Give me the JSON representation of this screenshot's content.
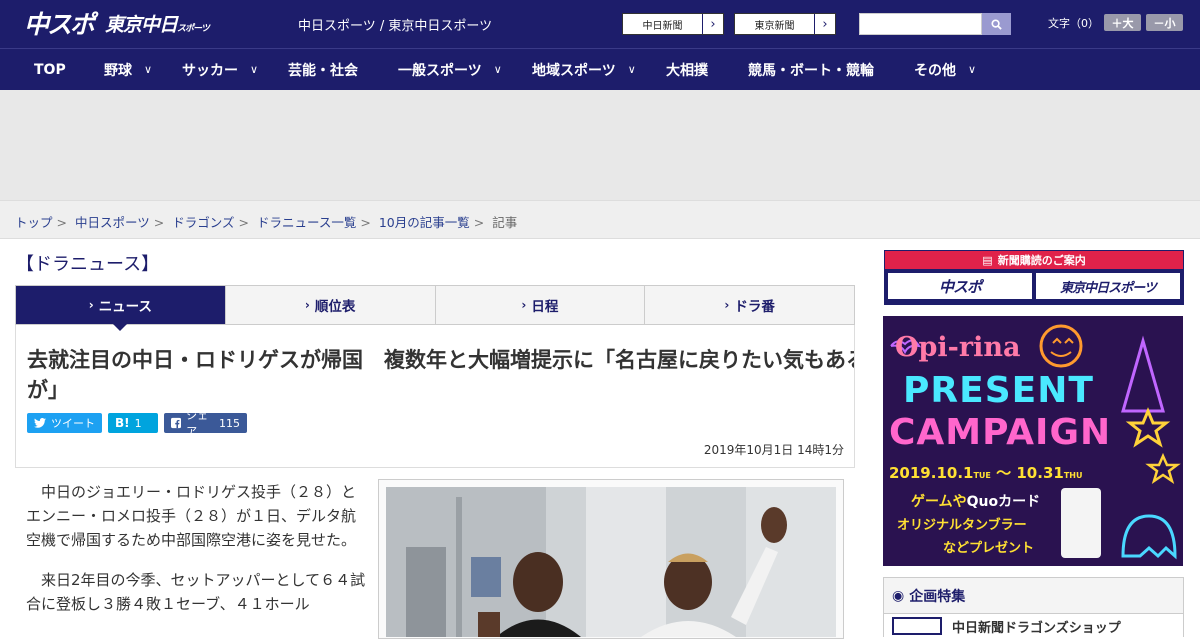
{
  "header": {
    "logo_main": "中スポ",
    "logo_sub": "東京中日",
    "logo_sub_small": "スポーツ",
    "site_links": "中日スポーツ / 東京中日スポーツ",
    "paper_buttons": [
      "中日新聞",
      "東京新聞"
    ],
    "search_placeholder": "",
    "font_label": "文字（0）",
    "font_up": "＋大",
    "font_down": "－小"
  },
  "nav": {
    "items": [
      {
        "label": "TOP",
        "dropdown": false
      },
      {
        "label": "野球",
        "dropdown": true
      },
      {
        "label": "サッカー",
        "dropdown": true
      },
      {
        "label": "芸能・社会",
        "dropdown": false
      },
      {
        "label": "一般スポーツ",
        "dropdown": true
      },
      {
        "label": "地域スポーツ",
        "dropdown": true
      },
      {
        "label": "大相撲",
        "dropdown": false
      },
      {
        "label": "競馬・ボート・競輪",
        "dropdown": false
      },
      {
        "label": "その他",
        "dropdown": true
      }
    ]
  },
  "breadcrumb": {
    "links": [
      "トップ",
      "中日スポーツ",
      "ドラゴンズ",
      "ドラニュース一覧",
      "10月の記事一覧"
    ],
    "current": "記事"
  },
  "section_title": "【ドラニュース】",
  "tabs": [
    {
      "label": "ニュース",
      "active": true
    },
    {
      "label": "順位表",
      "active": false
    },
    {
      "label": "日程",
      "active": false
    },
    {
      "label": "ドラ番",
      "active": false
    }
  ],
  "article": {
    "headline": "去就注目の中日・ロドリゲスが帰国　複数年と大幅増提示に「名古屋に戻りたい気もあるが」",
    "tweet_label": "ツイート",
    "hatena_label": "B!",
    "hatena_count": "1",
    "share_label": "シェア",
    "share_count": "115",
    "date": "2019年10月1日 14時1分",
    "paragraphs": [
      "中日のジョエリー・ロドリゲス投手（２８）とエンニー・ロメロ投手（２８）が１日、デルタ航空機で帰国するため中部国際空港に姿を見せた。",
      "来日2年目の今季、セットアッパーとして６４試合に登板し３勝４敗１セーブ、４１ホール"
    ]
  },
  "sidebar": {
    "subscribe_header": "新聞購読のご案内",
    "subscribe_buttons": [
      "中スポ",
      "東京中日スポーツ"
    ],
    "promo": {
      "brand": "Opi-rina",
      "line1": "PRESENT",
      "line2": "CAMPAIGN",
      "period_start": "2019.10.1",
      "period_start_day": "TUE",
      "period_tilde": "〜",
      "period_end": "10.31",
      "period_end_day": "THU",
      "text1": "ゲームや",
      "text1b": "Quoカード",
      "text2": "オリジナルタンブラー",
      "text3": "などプレゼント"
    },
    "feature_title": "企画特集",
    "feature_item": "中日新聞ドラゴンズショップ"
  },
  "colors": {
    "brand_navy": "#1d1d6b",
    "accent_red": "#e0224a",
    "twitter": "#1da1f2",
    "hatena": "#00a4de",
    "facebook": "#3b5998"
  }
}
